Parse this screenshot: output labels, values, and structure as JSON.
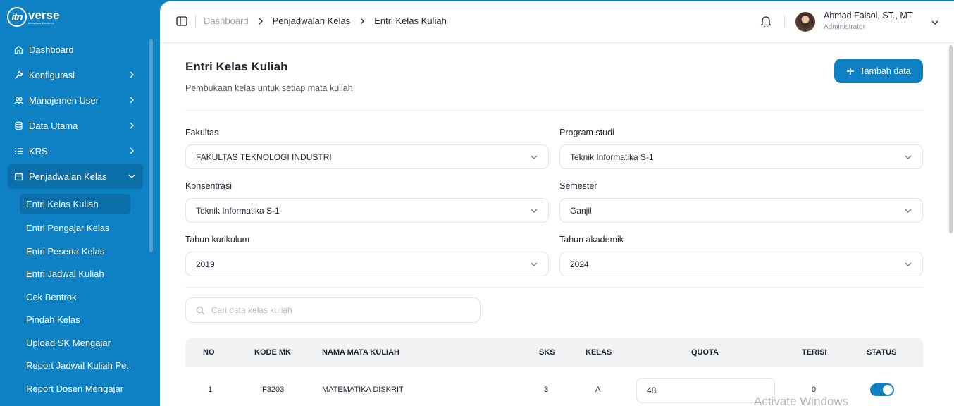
{
  "brand": {
    "word": "verse",
    "mark": "itn",
    "tagline": "techspace & network"
  },
  "sidebar": {
    "items": [
      {
        "label": "Dashboard",
        "icon": "home-icon"
      },
      {
        "label": "Konfigurasi",
        "icon": "wrench-icon"
      },
      {
        "label": "Manajemen User",
        "icon": "users-icon"
      },
      {
        "label": "Data Utama",
        "icon": "database-icon"
      },
      {
        "label": "KRS",
        "icon": "list-icon"
      },
      {
        "label": "Penjadwalan Kelas",
        "icon": "calendar-icon"
      }
    ],
    "sub_items": [
      "Entri Kelas Kuliah",
      "Entri Pengajar Kelas",
      "Entri Peserta Kelas",
      "Entri Jadwal Kuliah",
      "Cek Bentrok",
      "Pindah Kelas",
      "Upload SK Mengajar",
      "Report Jadwal Kuliah Pe...",
      "Report Dosen Mengajar"
    ]
  },
  "breadcrumb": [
    "Dashboard",
    "Penjadwalan Kelas",
    "Entri Kelas Kuliah"
  ],
  "user": {
    "name": "Ahmad Faisol, ST., MT",
    "role": "Administrator"
  },
  "page": {
    "title": "Entri Kelas Kuliah",
    "subtitle": "Pembukaan kelas untuk setiap mata kuliah",
    "add_button": "Tambah data"
  },
  "filters": {
    "fakultas": {
      "label": "Fakultas",
      "value": "FAKULTAS TEKNOLOGI INDUSTRI"
    },
    "program_studi": {
      "label": "Program studi",
      "value": "Teknik Informatika S-1"
    },
    "konsentrasi": {
      "label": "Konsentrasi",
      "value": "Teknik Informatika S-1"
    },
    "semester": {
      "label": "Semester",
      "value": "Ganjil"
    },
    "tahun_kurikulum": {
      "label": "Tahun kurikulum",
      "value": "2019"
    },
    "tahun_akademik": {
      "label": "Tahun akademik",
      "value": "2024"
    }
  },
  "search": {
    "placeholder": "Cari data kelas kuliah",
    "value": ""
  },
  "table": {
    "columns": [
      "NO",
      "KODE MK",
      "NAMA MATA KULIAH",
      "SKS",
      "KELAS",
      "QUOTA",
      "TERISI",
      "STATUS"
    ],
    "rows": [
      {
        "no": "1",
        "kode": "IF3203",
        "nama": "MATEMATIKA DISKRIT",
        "sks": "3",
        "kelas": "A",
        "quota": "48",
        "terisi": "0",
        "status": "on"
      }
    ]
  },
  "watermark": "Activate Windows",
  "colors": {
    "primary": "#0e81c4",
    "sidebar_active": "#0a6faa"
  }
}
